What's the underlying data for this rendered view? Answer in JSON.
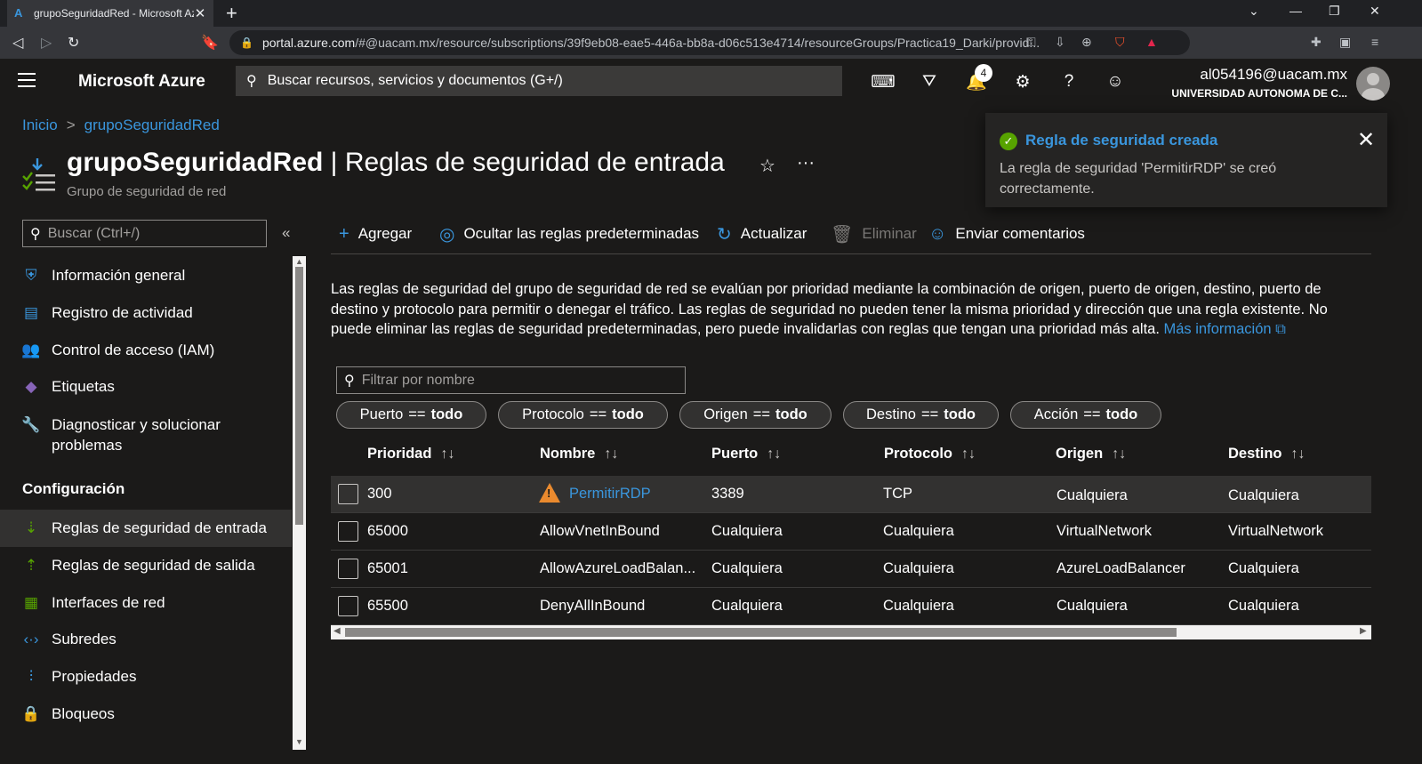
{
  "browser": {
    "tab_title": "grupoSeguridadRed - Microsoft Azure",
    "new_tab": "+",
    "url_host": "portal.azure.com",
    "url_path": "/#@uacam.mx/resource/subscriptions/39f9eb08-eae5-446a-bb8a-d06c513e4714/resourceGroups/Practica19_Darki/provid..."
  },
  "topbar": {
    "brand": "Microsoft Azure",
    "search_placeholder": "Buscar recursos, servicios y documentos (G+/)",
    "notification_count": "4",
    "user_email": "al054196@uacam.mx",
    "user_org": "UNIVERSIDAD AUTONOMA DE C..."
  },
  "breadcrumb": {
    "home": "Inicio",
    "sep": ">",
    "current": "grupoSeguridadRed"
  },
  "header": {
    "resource_name": "grupoSeguridadRed",
    "separator": " | ",
    "blade_title": "Reglas de seguridad de entrada",
    "subtitle": "Grupo de seguridad de red"
  },
  "toast": {
    "title": "Regla de seguridad creada",
    "message": "La regla de seguridad 'PermitirRDP' se creó correctamente."
  },
  "sidebar": {
    "search_placeholder": "Buscar (Ctrl+/)",
    "items": [
      {
        "label": "Información general"
      },
      {
        "label": "Registro de actividad"
      },
      {
        "label": "Control de acceso (IAM)"
      },
      {
        "label": "Etiquetas"
      },
      {
        "label": "Diagnosticar y solucionar problemas"
      }
    ],
    "section_title": "Configuración",
    "config_items": [
      {
        "label": "Reglas de seguridad de entrada"
      },
      {
        "label": "Reglas de seguridad de salida"
      },
      {
        "label": "Interfaces de red"
      },
      {
        "label": "Subredes"
      },
      {
        "label": "Propiedades"
      },
      {
        "label": "Bloqueos"
      }
    ]
  },
  "commands": {
    "add": "Agregar",
    "hide_defaults": "Ocultar las reglas predeterminadas",
    "refresh": "Actualizar",
    "delete": "Eliminar",
    "feedback": "Enviar comentarios"
  },
  "description": {
    "text": "Las reglas de seguridad del grupo de seguridad de red se evalúan por prioridad mediante la combinación de origen, puerto de origen, destino, puerto de destino y protocolo para permitir o denegar el tráfico. Las reglas de seguridad no pueden tener la misma prioridad y dirección que una regla existente. No puede eliminar las reglas de seguridad predeterminadas, pero puede invalidarlas con reglas que tengan una prioridad más alta.",
    "link": "Más información"
  },
  "filter": {
    "placeholder": "Filtrar por nombre"
  },
  "pills": [
    {
      "key": "Puerto",
      "op": "==",
      "val": "todo"
    },
    {
      "key": "Protocolo",
      "op": "==",
      "val": "todo"
    },
    {
      "key": "Origen",
      "op": "==",
      "val": "todo"
    },
    {
      "key": "Destino",
      "op": "==",
      "val": "todo"
    },
    {
      "key": "Acción",
      "op": "==",
      "val": "todo"
    }
  ],
  "table": {
    "columns": [
      "Prioridad",
      "Nombre",
      "Puerto",
      "Protocolo",
      "Origen",
      "Destino"
    ],
    "sort_glyph": "↑↓",
    "rows": [
      {
        "priority": "300",
        "name": "PermitirRDP",
        "port": "3389",
        "protocol": "TCP",
        "source": "Cualquiera",
        "dest": "Cualquiera"
      },
      {
        "priority": "65000",
        "name": "AllowVnetInBound",
        "port": "Cualquiera",
        "protocol": "Cualquiera",
        "source": "VirtualNetwork",
        "dest": "VirtualNetwork"
      },
      {
        "priority": "65001",
        "name": "AllowAzureLoadBalan...",
        "port": "Cualquiera",
        "protocol": "Cualquiera",
        "source": "AzureLoadBalancer",
        "dest": "Cualquiera"
      },
      {
        "priority": "65500",
        "name": "DenyAllInBound",
        "port": "Cualquiera",
        "protocol": "Cualquiera",
        "source": "Cualquiera",
        "dest": "Cualquiera"
      }
    ]
  },
  "colors": {
    "accent": "#3a96dd",
    "success": "#57a300",
    "warning": "#ea8a2e",
    "background": "#1b1a19"
  }
}
